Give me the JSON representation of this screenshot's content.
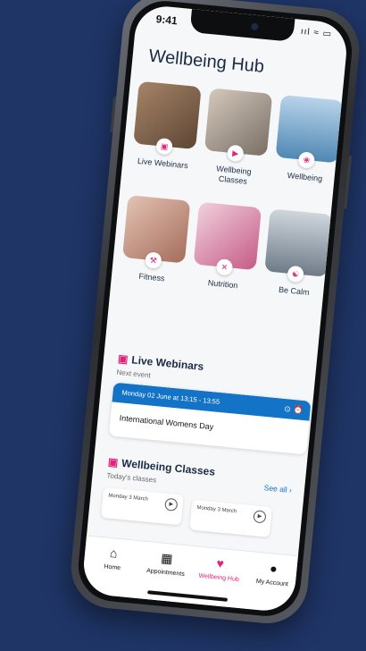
{
  "status": {
    "time": "9:41",
    "icons": "ııl ≈ ▭"
  },
  "page": {
    "title": "Wellbeing Hub"
  },
  "tiles": [
    {
      "label": "Live Webinars",
      "icon": "calendar-icon",
      "color": "#8a6a4e"
    },
    {
      "label": "Wellbeing Classes",
      "icon": "play-icon",
      "color": "#b8a99a"
    },
    {
      "label": "Wellbeing",
      "icon": "lotus-icon",
      "color": "#6b9bbf"
    },
    {
      "label": "Fitness",
      "icon": "dumbbell-icon",
      "color": "#c79a8a"
    },
    {
      "label": "Nutrition",
      "icon": "cutlery-icon",
      "color": "#d9a0b5"
    },
    {
      "label": "Be Calm",
      "icon": "meditation-icon",
      "color": "#8e9aa6"
    }
  ],
  "webinars": {
    "heading": "Live Webinars",
    "next_label": "Next event",
    "event_date": "Monday 02 June at 13:15 - 13:55",
    "event_title": "International Womens Day"
  },
  "classes": {
    "heading": "Wellbeing Classes",
    "today_label": "Today's classes",
    "see_all": "See all",
    "cards": [
      {
        "date": "Monday 3 March"
      },
      {
        "date": "Monday 3 March"
      }
    ]
  },
  "tabbar": {
    "items": [
      {
        "label": "Home",
        "icon": "home-icon"
      },
      {
        "label": "Appointments",
        "icon": "calendar-icon"
      },
      {
        "label": "Wellbeing Hub",
        "icon": "hub-icon"
      },
      {
        "label": "My Account",
        "icon": "account-icon"
      }
    ],
    "active": "Wellbeing Hub"
  },
  "colors": {
    "accent": "#e0247a",
    "primary": "#1373c7",
    "background": "#1f3566"
  }
}
